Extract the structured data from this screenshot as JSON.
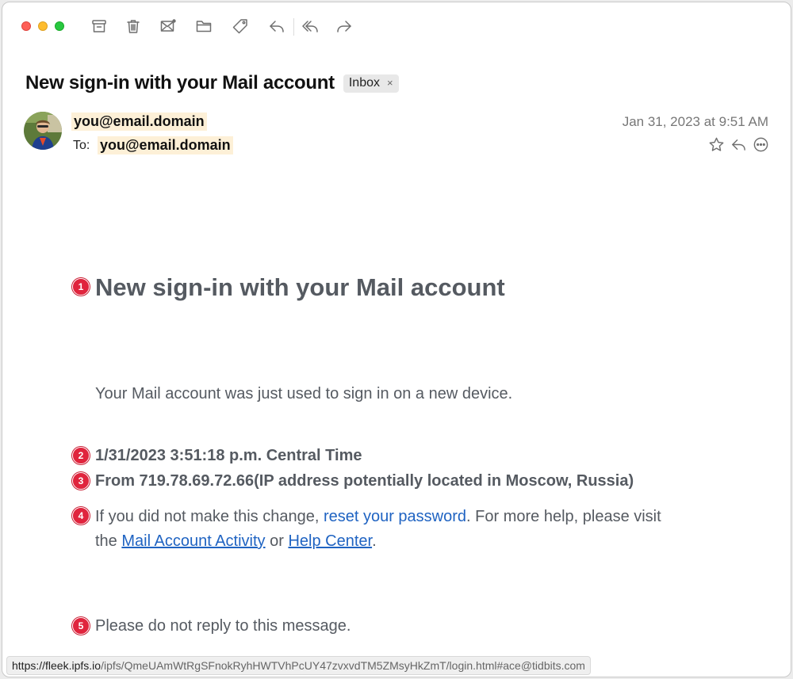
{
  "toolbar": {
    "buttons": [
      "archive-icon",
      "trash-icon",
      "envelope-icon",
      "folder-icon",
      "tag-icon",
      "reply-icon",
      "reply-all-icon",
      "forward-icon"
    ]
  },
  "message": {
    "subject": "New sign-in with your Mail account",
    "mailbox_tag": "Inbox",
    "mailbox_tag_close": "×",
    "from": "you@email.domain",
    "to_label": "To:",
    "to": "you@email.domain",
    "date": "Jan 31, 2023 at 9:51 AM"
  },
  "body": {
    "heading": "New sign-in with your Mail account",
    "intro": "Your Mail account was just used to sign in on a new device.",
    "datetime": "1/31/2023 3:51:18 p.m. Central Time",
    "location": "From 719.78.69.72.66(IP address potentially located in Moscow, Russia)",
    "help_prefix": "If you did not make this change, ",
    "help_link_reset": "reset your password",
    "help_mid": ". For more help, please visit",
    "help_the": "the ",
    "help_link_activity": "Mail Account Activity",
    "help_or": " or ",
    "help_link_center": "Help Center",
    "help_end": ".",
    "noreply": "Please do not reply to this message."
  },
  "markers": [
    "1",
    "2",
    "3",
    "4",
    "5"
  ],
  "statusbar": {
    "domain": "https://fleek.ipfs.io",
    "path": "/ipfs/QmeUAmWtRgSFnokRyhHWTVhPcUY47zvxvdTM5ZMsyHkZmT/login.html#ace@tidbits.com"
  },
  "colors": {
    "highlight": "#fdf0d7",
    "marker": "#e0243d",
    "link": "#1f63c2",
    "body_text": "#555a61"
  }
}
